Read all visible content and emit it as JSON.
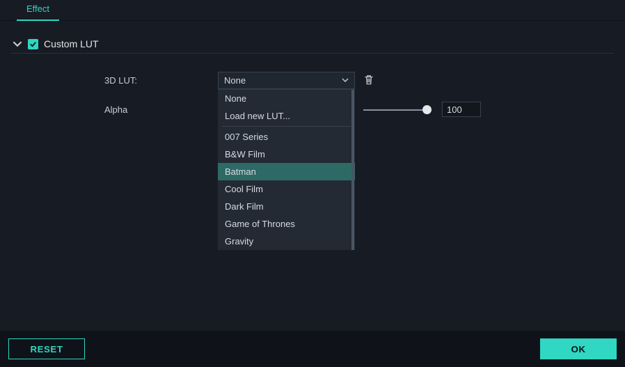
{
  "tab": {
    "label": "Effect"
  },
  "section": {
    "title": "Custom LUT",
    "checked": true
  },
  "labels": {
    "lut": "3D LUT:",
    "alpha": "Alpha"
  },
  "select": {
    "value": "None"
  },
  "dropdown": {
    "top": [
      "None",
      "Load new LUT..."
    ],
    "rest": [
      "007 Series",
      "B&W Film",
      "Batman",
      "Cool Film",
      "Dark Film",
      "Game of Thrones",
      "Gravity"
    ],
    "highlighted": "Batman"
  },
  "alpha": {
    "value": "100"
  },
  "buttons": {
    "reset": "RESET",
    "ok": "OK"
  }
}
